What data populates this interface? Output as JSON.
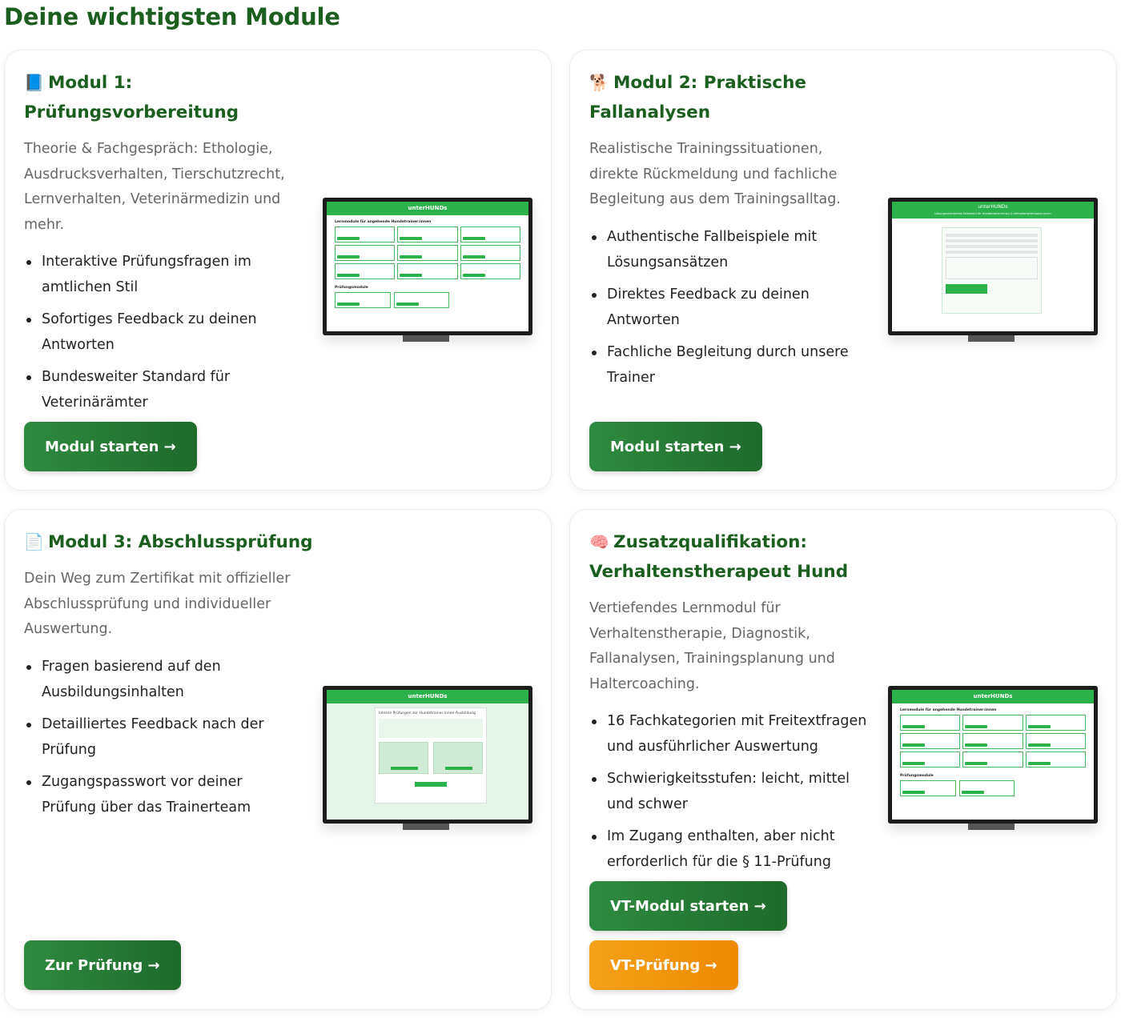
{
  "page": {
    "title": "Deine wichtigsten Module"
  },
  "modules": [
    {
      "icon": "📘",
      "title": "Modul 1: Prüfungsvorbereitung",
      "description": "Theorie & Fachgespräch: Ethologie, Ausdrucksverhalten, Tierschutzrecht, Lernverhalten, Veterinärmedizin und mehr.",
      "bullets": [
        "Interaktive Prüfungsfragen im amtlichen Stil",
        "Sofortiges Feedback zu deinen Antworten",
        "Bundesweiter Standard für Veterinärämter"
      ],
      "button": "Modul starten →"
    },
    {
      "icon": "🐕",
      "title": "Modul 2: Praktische Fallanalysen",
      "description": "Realistische Trainingssituationen, direkte Rückmeldung und fachliche Begleitung aus dem Trainingsalltag.",
      "bullets": [
        "Authentische Fallbeispiele mit Lösungsansätzen",
        "Direktes Feedback zu deinen Antworten",
        "Fachliche Begleitung durch unsere Trainer"
      ],
      "button": "Modul starten →"
    },
    {
      "icon": "📄",
      "title": "Modul 3: Abschlussprüfung",
      "description": "Dein Weg zum Zertifikat mit offizieller Abschlussprüfung und individueller Auswertung.",
      "bullets": [
        "Fragen basierend auf den Ausbildungsinhalten",
        "Detailliertes Feedback nach der Prüfung",
        "Zugangspasswort vor deiner Prüfung über das Trainerteam"
      ],
      "button": "Zur Prüfung →"
    },
    {
      "icon": "🧠",
      "title": "Zusatzqualifikation: Verhaltenstherapeut Hund",
      "description": "Vertiefendes Lernmodul für Verhaltenstherapie, Diagnostik, Fallanalysen, Trainingsplanung und Haltercoaching.",
      "bullets": [
        "16 Fachkategorien mit Freitextfragen und ausführlicher Auswertung",
        "Schwierigkeitsstufen: leicht, mittel und schwer",
        "Im Zugang enthalten, aber nicht erforderlich für die § 11-Prüfung"
      ],
      "button": "VT-Modul starten →",
      "button2": "VT-Prüfung →"
    }
  ],
  "screens": {
    "brand": "unterHUNDs",
    "lernmodule": "Lernmodule für angehende Hundetrainer:innen",
    "pruefungsmodule": "Prüfungsmodule",
    "fall_header": "Lösungsorientiertes Fallmodul für Hundetrainer:innen & Verhaltenstherapeut:innen",
    "exam_title": "Interne Prüfungen zur Hundetrainer:innen-Ausbildung"
  },
  "colors": {
    "primary": "#1b5e20",
    "button": "#2e8b3e",
    "accent_orange": "#f39200"
  }
}
